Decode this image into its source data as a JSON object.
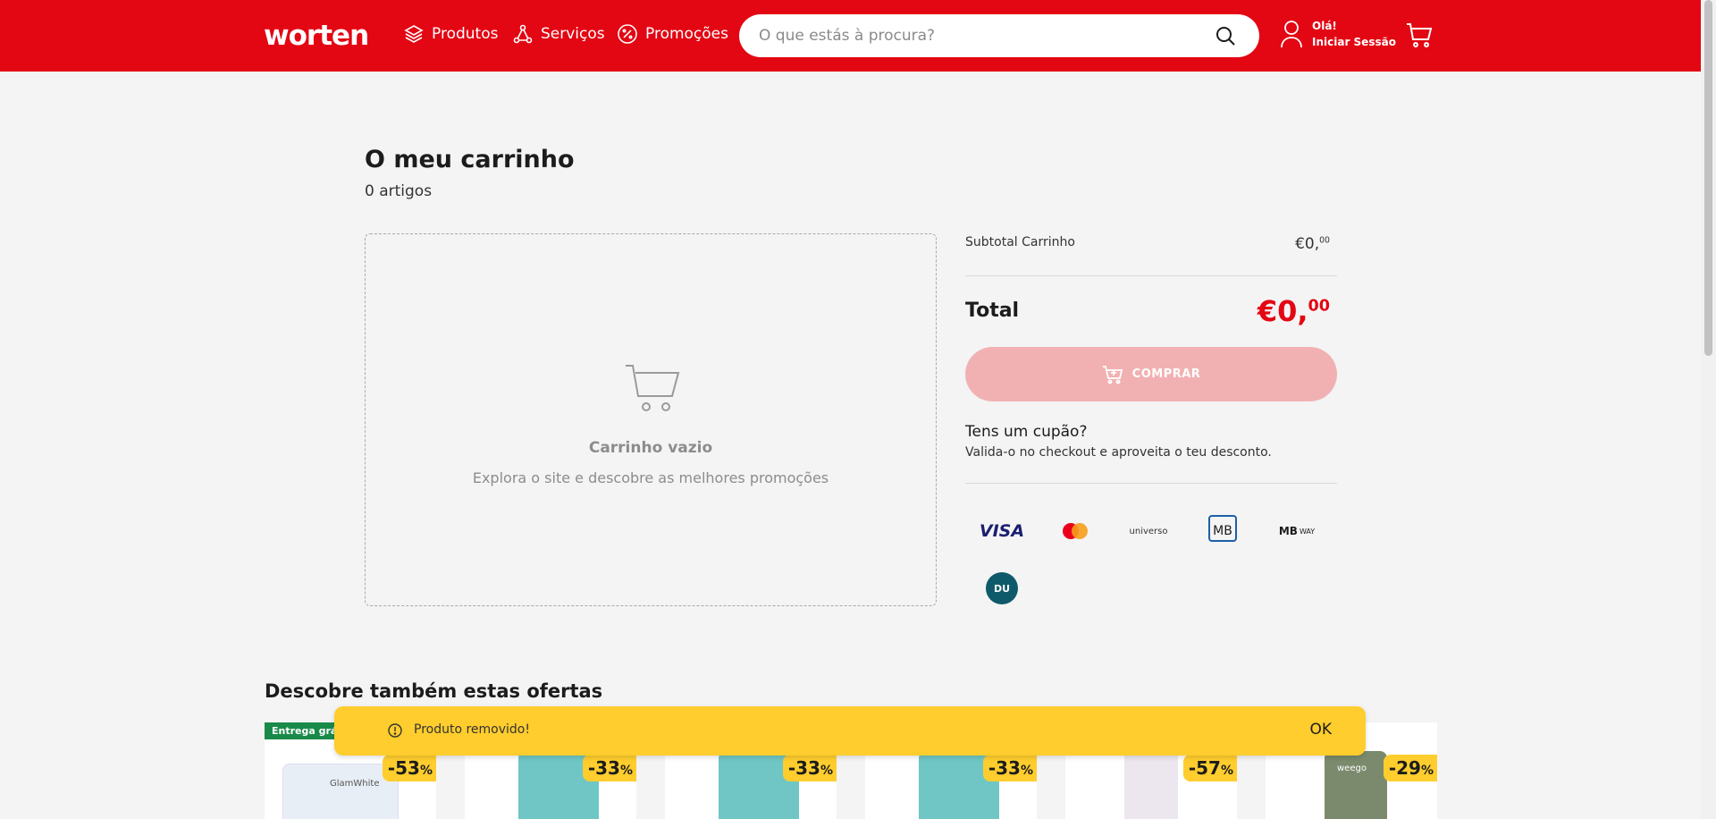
{
  "header": {
    "logo": "worten",
    "nav": [
      {
        "label": "Produtos",
        "icon": "layers-icon"
      },
      {
        "label": "Serviços",
        "icon": "services-icon"
      },
      {
        "label": "Promoções",
        "icon": "percent-badge-icon"
      }
    ],
    "search_placeholder": "O que estás à procura?",
    "account_greeting": "Olá!",
    "account_action": "Iniciar Sessão"
  },
  "cart": {
    "title": "O meu carrinho",
    "item_count": "0 artigos",
    "empty_title": "Carrinho vazio",
    "empty_subtitle": "Explora o site e descobre as melhores promoções"
  },
  "summary": {
    "subtotal_label": "Subtotal Carrinho",
    "subtotal_main": "€0,",
    "subtotal_cents": "00",
    "total_label": "Total",
    "total_main": "€0,",
    "total_cents": "00",
    "buy_label": "COMPRAR",
    "coupon_title": "Tens um cupão?",
    "coupon_subtitle": "Valida-o no checkout e aproveita o teu desconto.",
    "payment_methods": [
      "VISA",
      "Mastercard",
      "universo",
      "Multibanco",
      "MB WAY",
      "DU"
    ]
  },
  "offers": {
    "title": "Descobre também estas ofertas",
    "free_delivery_badge": "Entrega grát",
    "items": [
      {
        "discount": "-53",
        "brand": "GlamWhite"
      },
      {
        "discount": "-33"
      },
      {
        "discount": "-33"
      },
      {
        "discount": "-33"
      },
      {
        "discount": "-57"
      },
      {
        "discount": "-29",
        "brand": "weego"
      }
    ],
    "pct_symbol": "%"
  },
  "toast": {
    "message": "Produto removido!",
    "ok_label": "OK"
  },
  "colors": {
    "brand_red": "#e30613",
    "button_disabled": "#f1b1b2",
    "toast_yellow": "#ffcd2d",
    "discount_yellow": "#ffcd2d"
  }
}
